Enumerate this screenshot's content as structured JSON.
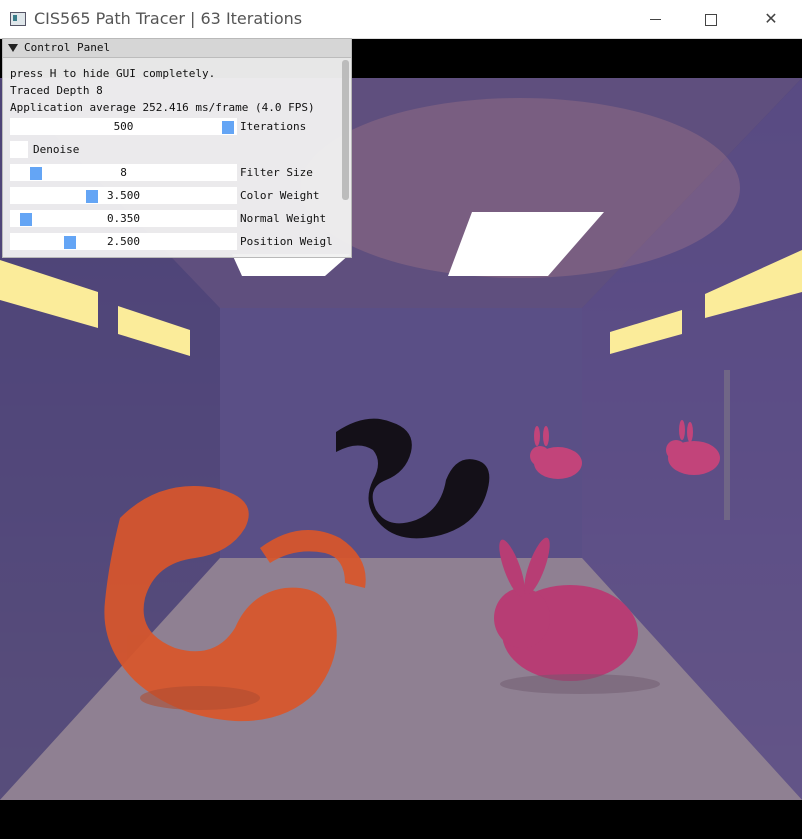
{
  "window": {
    "title": "CIS565 Path Tracer | 63 Iterations",
    "controls": [
      "minimize",
      "maximize",
      "close"
    ]
  },
  "panel": {
    "header": "Control Panel",
    "info_lines": [
      "press H to hide GUI completely.",
      "Traced Depth 8",
      "Application average 252.416 ms/frame (4.0 FPS)"
    ],
    "controls": {
      "iterations": {
        "value": "500",
        "label": "Iterations",
        "level": 1.0
      },
      "denoise": {
        "label": "Denoise",
        "checked": false
      },
      "filter_size": {
        "value": "8",
        "label": "Filter Size",
        "level": 0.05
      },
      "color_weight": {
        "value": "3.500",
        "label": "Color Weight",
        "level": 0.35
      },
      "normal_weight": {
        "value": "0.350",
        "label": "Normal Weight",
        "level": 0.035
      },
      "position_weight": {
        "value": "2.500",
        "label": "Position Weigl",
        "level": 0.25
      }
    }
  },
  "colors": {
    "slider_knob": "#64a5f5",
    "panel_bg": "#f0f0f0",
    "dragon_orange": "#d9562a",
    "bunny_pink": "#c2447a"
  }
}
